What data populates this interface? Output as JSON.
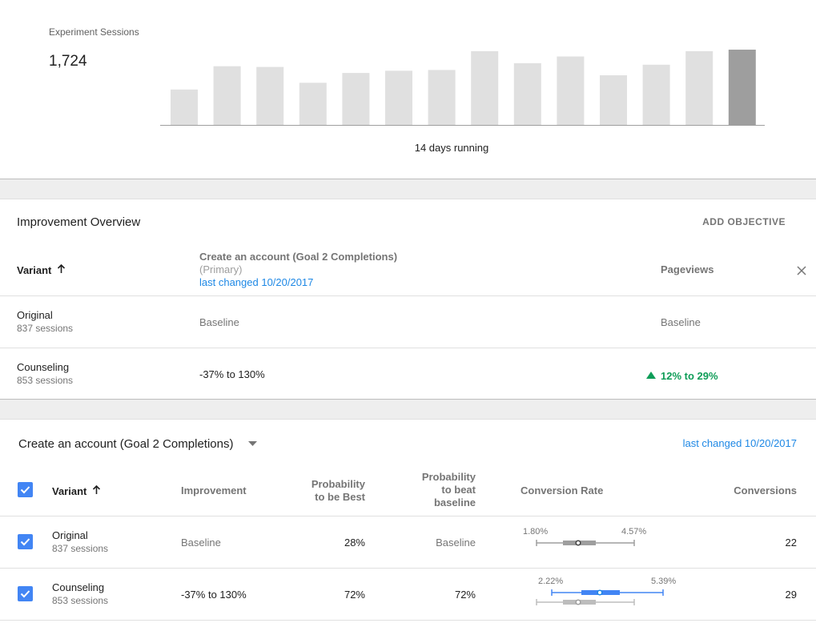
{
  "sessions": {
    "label": "Experiment Sessions",
    "total": "1,724",
    "running_text": "14 days running",
    "bars": [
      0.47,
      0.78,
      0.77,
      0.56,
      0.69,
      0.72,
      0.73,
      0.98,
      0.82,
      0.91,
      0.66,
      0.8,
      0.98,
      1.0
    ],
    "bar_color": "#e0e0e0",
    "current_bar_color": "#9e9e9e"
  },
  "overview": {
    "title": "Improvement Overview",
    "add_objective": "ADD OBJECTIVE",
    "col_variant": "Variant",
    "col_goal": "Create an account (Goal 2 Completions)",
    "col_goal_primary": "(Primary)",
    "col_goal_changed": "last changed 10/20/2017",
    "col_pageviews": "Pageviews",
    "rows": [
      {
        "name": "Original",
        "sessions": "837 sessions",
        "goal": "Baseline",
        "pageviews": "Baseline"
      },
      {
        "name": "Counseling",
        "sessions": "853 sessions",
        "goal": "-37% to 130%",
        "pageviews": "12% to 29%"
      }
    ],
    "positive_color": "#0f9d58"
  },
  "detail": {
    "objective": "Create an account (Goal 2 Completions)",
    "changed": "last changed 10/20/2017",
    "headers": {
      "variant": "Variant",
      "improvement": "Improvement",
      "prob_best_1": "Probability",
      "prob_best_2": "to be Best",
      "prob_beat_1": "Probability",
      "prob_beat_2": "to beat",
      "prob_beat_3": "baseline",
      "conversion_rate": "Conversion Rate",
      "conversions": "Conversions"
    },
    "rows": [
      {
        "name": "Original",
        "sessions": "837 sessions",
        "improvement": "Baseline",
        "prob_best": "28%",
        "prob_beat": "Baseline",
        "cr_low": "1.80%",
        "cr_high": "4.57%",
        "conversions": "22"
      },
      {
        "name": "Counseling",
        "sessions": "853 sessions",
        "improvement": "-37% to 130%",
        "prob_best": "72%",
        "prob_beat": "72%",
        "cr_low": "2.22%",
        "cr_high": "5.39%",
        "conversions": "29"
      }
    ],
    "accent_color": "#4285f4"
  }
}
